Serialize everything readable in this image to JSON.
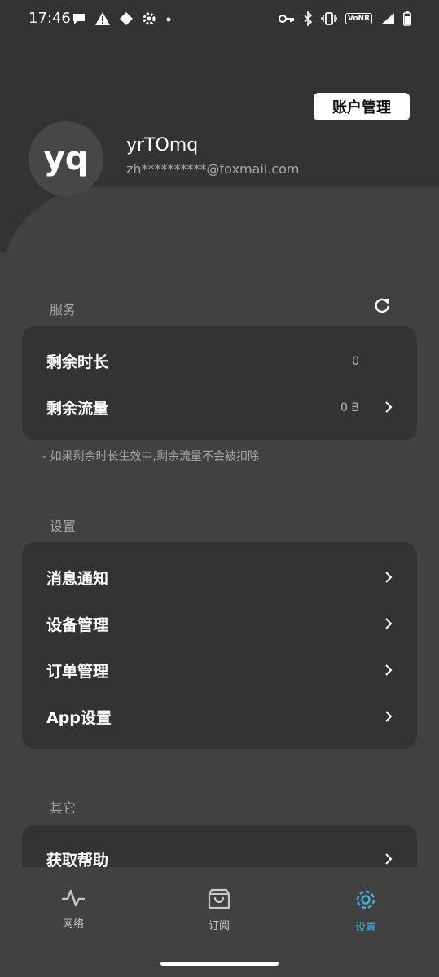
{
  "status_bar": {
    "time": "17:46",
    "left_icons": [
      "chat-bubble-icon",
      "warning-icon",
      "diamond-icon",
      "gear-icon",
      "dot-icon"
    ],
    "right_icons": [
      "key-icon",
      "bluetooth-icon",
      "vibrate-icon",
      "vonr-icon",
      "signal-icon",
      "battery-icon"
    ],
    "vonr_label": "VoNR"
  },
  "profile": {
    "avatar_text": "yq",
    "username": "yrTOmq",
    "email": "zh**********@foxmail.com",
    "account_button": "账户管理"
  },
  "services": {
    "title": "服务",
    "items": [
      {
        "label": "剩余时长",
        "value": "0",
        "chevron": false
      },
      {
        "label": "剩余流量",
        "value": "0 B",
        "chevron": true
      }
    ],
    "note": "- 如果剩余时长生效中,剩余流量不会被扣除"
  },
  "settings": {
    "title": "设置",
    "items": [
      {
        "label": "消息通知"
      },
      {
        "label": "设备管理"
      },
      {
        "label": "订单管理"
      },
      {
        "label": "App设置"
      }
    ]
  },
  "other": {
    "title": "其它",
    "items": [
      {
        "label": "获取帮助"
      }
    ]
  },
  "bottom_nav": {
    "items": [
      {
        "label": "网络",
        "icon": "activity-icon",
        "active": false
      },
      {
        "label": "订阅",
        "icon": "shopping-bag-icon",
        "active": false
      },
      {
        "label": "设置",
        "icon": "gear-icon",
        "active": true
      }
    ],
    "active_color": "#3fb2e2"
  },
  "colors": {
    "background": "#414141",
    "card": "#333333",
    "accent": "#3fb2e2"
  }
}
